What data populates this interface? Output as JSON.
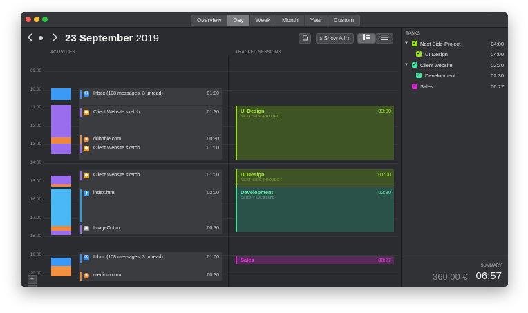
{
  "window": {
    "tabs": [
      "Overview",
      "Day",
      "Week",
      "Month",
      "Year",
      "Custom"
    ],
    "active_tab": "Day"
  },
  "header": {
    "date_day": "23 September",
    "date_year": "2019",
    "show_all_label": "Show All",
    "share_icon": "share-icon",
    "prev_icon": "chevron-left-icon",
    "next_icon": "chevron-right-icon",
    "today_icon": "dot-icon"
  },
  "columns": {
    "activities": "ACTIVITIES",
    "tracked": "TRACKED SESSIONS"
  },
  "hours": [
    "09:00",
    "10:00",
    "11:00",
    "12:00",
    "13:00",
    "14:00",
    "15:00",
    "16:00",
    "17:00",
    "18:00",
    "19:00",
    "20:00"
  ],
  "activity_groups": [
    {
      "rows": [
        {
          "label": "Inbox (108 messages, 3 unread)",
          "duration": "01:00",
          "icon": "mail-icon",
          "color": "#3a8ef0"
        }
      ]
    },
    {
      "rows": [
        {
          "label": "Client Website.sketch",
          "duration": "01:30",
          "icon": "sketch-icon",
          "color": "#f0a020"
        },
        {
          "label": "dribbble.com",
          "duration": "00:30",
          "icon": "chrome-icon",
          "color": "#e8883a"
        },
        {
          "label": "Client Website.sketch",
          "duration": "01:00",
          "icon": "sketch-icon",
          "color": "#f0a020"
        }
      ]
    },
    {
      "rows": [
        {
          "label": "Client Website.sketch",
          "duration": "01:00",
          "icon": "sketch-icon",
          "color": "#f0a020"
        },
        {
          "label": "index.html",
          "duration": "02:00",
          "icon": "vscode-icon",
          "color": "#2f9ee8"
        },
        {
          "label": "ImageOptim",
          "duration": "00:30",
          "icon": "imageoptim-icon",
          "color": "#8a8a8a"
        }
      ]
    },
    {
      "rows": [
        {
          "label": "Inbox (108 messages, 3 unread)",
          "duration": "01:00",
          "icon": "mail-icon",
          "color": "#3a8ef0"
        },
        {
          "label": "medium.com",
          "duration": "00:30",
          "icon": "chrome-icon",
          "color": "#e8883a"
        }
      ]
    }
  ],
  "sessions": [
    {
      "title": "UI Design",
      "project": "NEXT SIDE-PROJECT",
      "duration": "03:00",
      "color": "#9be21a"
    },
    {
      "title": "UI Design",
      "project": "NEXT SIDE-PROJECT",
      "duration": "01:00",
      "color": "#9be21a"
    },
    {
      "title": "Development",
      "project": "CLIENT WEBSITE",
      "duration": "02:30",
      "color": "#3ee8a0"
    },
    {
      "title": "Sales",
      "project": "",
      "duration": "00:27",
      "color": "#e02ad8"
    }
  ],
  "tasks": {
    "header": "TASKS",
    "items": [
      {
        "name": "Next Side-Project",
        "duration": "04:00",
        "color": "#9be21a",
        "expanded": true
      },
      {
        "name": "UI Design",
        "duration": "04:00",
        "color": "#9be21a"
      },
      {
        "name": "Client website",
        "duration": "02:30",
        "color": "#3ee8a0",
        "expanded": true
      },
      {
        "name": "Development",
        "duration": "02:30",
        "color": "#3ee8a0"
      },
      {
        "name": "Sales",
        "duration": "00:27",
        "color": "#e02ad8"
      }
    ]
  },
  "summary": {
    "label": "SUMMARY",
    "amount": "360,00 €",
    "total": "06:57"
  },
  "zoom": {
    "in": "+",
    "out": "−"
  }
}
